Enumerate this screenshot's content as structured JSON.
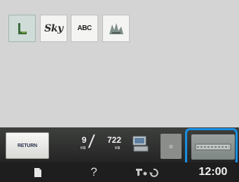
{
  "toolbar": {
    "items": [
      {
        "name": "embroidery-pattern-icon",
        "selected": true
      },
      {
        "name": "script-font-tab",
        "label": "Sky"
      },
      {
        "name": "block-font-tab",
        "label": "ABC"
      },
      {
        "name": "small-pattern-icon"
      }
    ]
  },
  "footer": {
    "return_label": "RETURN",
    "memory": {
      "used": "9",
      "total": "722",
      "unit": "KB"
    },
    "clock": "12:00"
  },
  "icons": {
    "page": "page-icon",
    "help": "?",
    "settings": "machine-settings-icon"
  },
  "colors": {
    "highlight": "#1a8fe2",
    "screen": "#d3d4d3",
    "bar": "#2e2f2e"
  }
}
